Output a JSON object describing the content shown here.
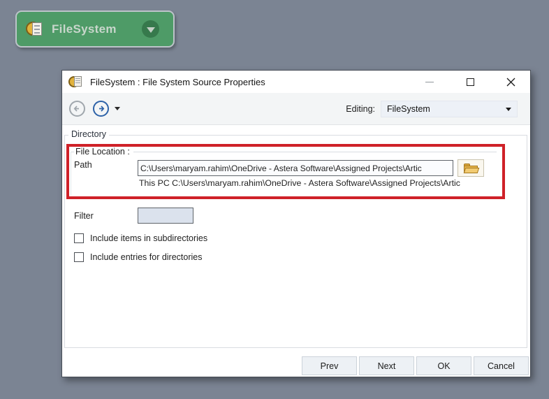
{
  "colors": {
    "canvas_background": "#7b8493",
    "node_green": "#4e9b67",
    "annotation_red": "#cf2128",
    "forward_blue": "#2d62a8",
    "folder_gold": "#e8b64c"
  },
  "canvas": {
    "node": {
      "label": "FileSystem",
      "dropdown_icon": "chevron-down-icon",
      "type_icon": "filesystem-document-icon"
    }
  },
  "dialog": {
    "title": "FileSystem : File System Source Properties",
    "window_icons": [
      "minimize-icon",
      "maximize-icon",
      "close-icon"
    ],
    "toolbar": {
      "back_icon": "arrow-left-circle-icon",
      "forward_icon": "arrow-right-circle-icon",
      "editing_label": "Editing:",
      "editing_value": "FileSystem"
    },
    "directory_group": {
      "label": "Directory",
      "file_location": {
        "label": "File Location :",
        "path_label": "Path",
        "path_value": "C:\\Users\\maryam.rahim\\OneDrive - Astera Software\\Assigned Projects\\Artic",
        "browse_icon": "open-folder-icon",
        "resolved_path": "This PC C:\\Users\\maryam.rahim\\OneDrive - Astera Software\\Assigned Projects\\Artic"
      },
      "filter": {
        "label": "Filter",
        "value": ""
      },
      "checkboxes": [
        {
          "label": "Include items in subdirectories",
          "checked": false
        },
        {
          "label": "Include entries for directories",
          "checked": false
        }
      ]
    },
    "footer_buttons": [
      "Prev",
      "Next",
      "OK",
      "Cancel"
    ]
  }
}
